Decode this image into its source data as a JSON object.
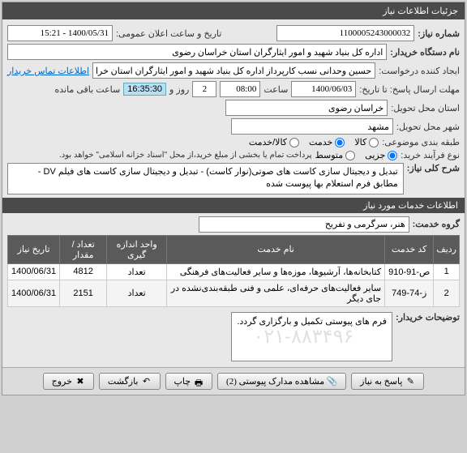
{
  "panel_title": "جزئیات اطلاعات نیاز",
  "fields": {
    "req_no_label": "شماره نیاز:",
    "req_no": "1100005243000032",
    "announce_label": "تاریخ و ساعت اعلان عمومی:",
    "announce_val": "1400/05/31 - 15:21",
    "buyer_label": "نام دستگاه خریدار:",
    "buyer_val": "اداره کل بنیاد شهید و امور ایثارگران استان خراسان رضوی",
    "creator_label": "ایجاد کننده درخواست:",
    "creator_val": "حسین وحدانی نسب کارپرداز اداره کل بنیاد شهید و امور ایثارگران استان خراسا",
    "contact_link": "اطلاعات تماس خریدار",
    "deadline_label": "مهلت ارسال پاسخ: تا تاریخ:",
    "deadline_date": "1400/06/03",
    "time_label": "ساعت",
    "deadline_time": "08:00",
    "days": "2",
    "days_label": "روز و",
    "remain_time": "16:35:30",
    "remain_label": "ساعت باقی مانده",
    "province_label": "استان محل تحویل:",
    "province_val": "خراسان رضوی",
    "city_label": "شهر محل تحویل:",
    "city_val": "مشهد",
    "subject_type_label": "طبقه بندی موضوعی:",
    "radio_goods": "کالا",
    "radio_service": "خدمت",
    "radio_both": "کالا/خدمت",
    "process_label": "نوع فرآیند خرید:",
    "radio_small": "جزیی",
    "radio_medium": "متوسط",
    "process_note": "پرداخت تمام یا بخشی از مبلغ خرید،از محل \"اسناد خزانه اسلامی\" خواهد بود.",
    "desc_label": "شرح کلی نیاز:",
    "desc_text": "تبدیل و دیجیتال سازی کاست های صوتی(نوار کاست) - تبدیل و دیجیتال سازی کاست های فیلم DV - مطابق فرم استعلام بها پیوست شده",
    "services_header": "اطلاعات خدمات مورد نیاز",
    "group_label": "گروه خدمت:",
    "group_val": "هنر، سرگرمی و تفریح"
  },
  "table": {
    "headers": [
      "ردیف",
      "کد خدمت",
      "نام خدمت",
      "واحد اندازه گیری",
      "تعداد / مقدار",
      "تاریخ نیاز"
    ],
    "rows": [
      [
        "1",
        "ص-91-910",
        "کتابخانه‌ها، آرشیوها، موزه‌ها و سایر فعالیت‌های فرهنگی",
        "تعداد",
        "4812",
        "1400/06/31"
      ],
      [
        "2",
        "ز-74-749",
        "سایر فعالیت‌های حرفه‌ای، علمی و فنی طبقه‌بندی‌نشده در جای دیگر",
        "تعداد",
        "2151",
        "1400/06/31"
      ]
    ]
  },
  "buyer_notes_label": "توضیحات خریدار:",
  "buyer_notes": "فرم های پیوستی تکمیل و بارگزاری گردد.",
  "watermark": "۰۲۱-۸۸۳۴۹۶",
  "buttons": {
    "reply": "پاسخ به نیاز",
    "attachments": "مشاهده مدارک پیوستی (2)",
    "print": "چاپ",
    "back": "بازگشت",
    "exit": "خروج"
  },
  "icons": {
    "reply": "✎",
    "attach": "📎",
    "print": "🖶",
    "back": "↶",
    "exit": "✖"
  }
}
